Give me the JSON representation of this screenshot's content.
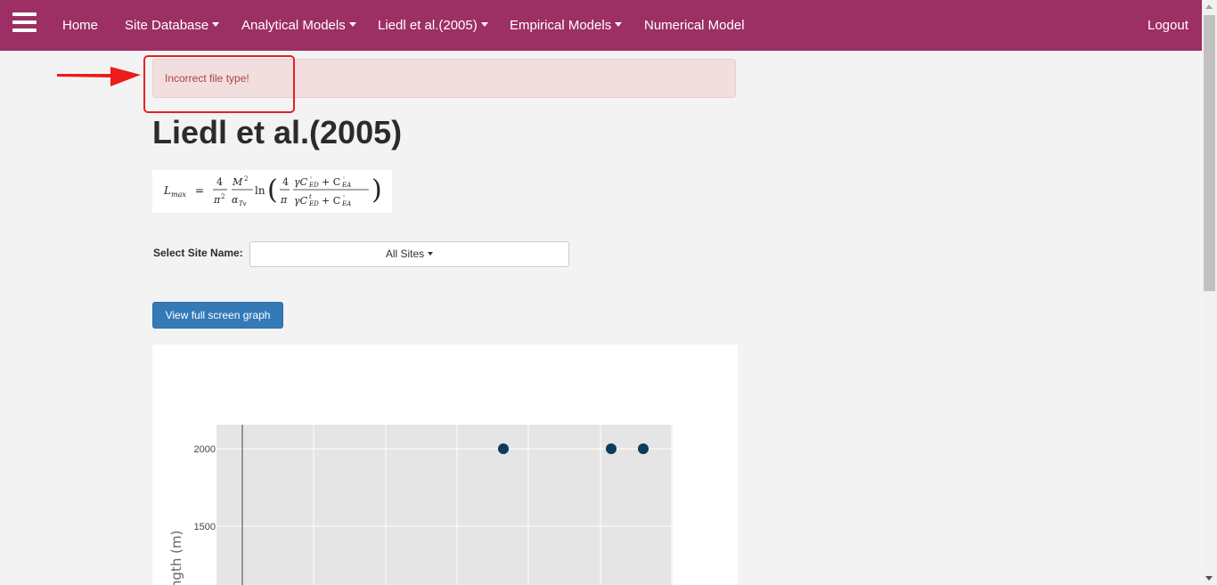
{
  "nav": {
    "home": "Home",
    "site_database": "Site Database",
    "analytical_models": "Analytical Models",
    "liedl": "Liedl et al.(2005)",
    "empirical_models": "Empirical Models",
    "numerical_model": "Numerical Model",
    "logout": "Logout"
  },
  "alert": {
    "message": "Incorrect file type!"
  },
  "page": {
    "title": "Liedl et al.(2005)"
  },
  "formula": {
    "text": "Lmax = (4/π²)(M²/αTv) ln( (4/π)(γC°ED + C°EA)/(γCtED + C°EA) )"
  },
  "site_select": {
    "label": "Select Site Name:",
    "value": "All Sites"
  },
  "buttons": {
    "full_screen_graph": "View full screen graph"
  },
  "colors": {
    "navbar": "#9c2f63",
    "primary": "#337ab7",
    "alert_bg": "#f2dede",
    "alert_text": "#a94442",
    "marker": "#0b3c5d"
  },
  "chart_data": {
    "type": "scatter",
    "ylabel": "Length (m)",
    "yticks": [
      2000,
      1500
    ],
    "points": [
      {
        "y": 2000
      },
      {
        "y": 2000
      },
      {
        "y": 2000
      }
    ]
  }
}
